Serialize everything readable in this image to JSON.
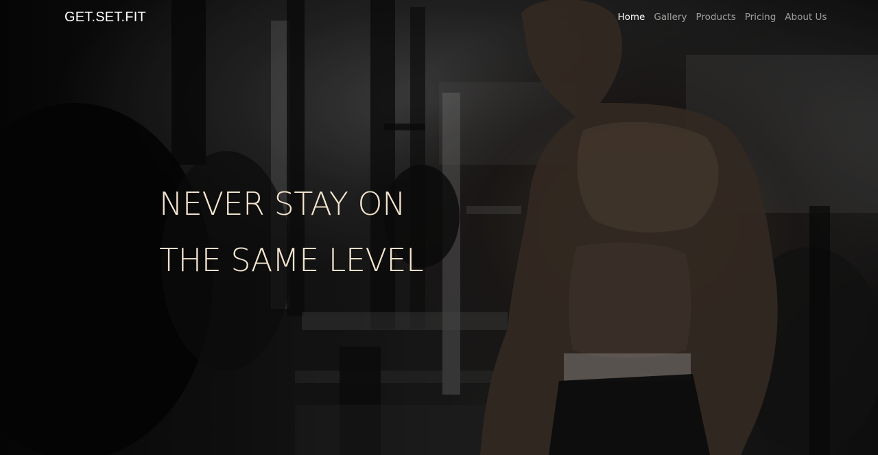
{
  "brand": {
    "name": "GET.SET.FIT"
  },
  "nav": {
    "items": [
      {
        "label": "Home",
        "active": true
      },
      {
        "label": "Gallery",
        "active": false
      },
      {
        "label": "Products",
        "active": false
      },
      {
        "label": "Pricing",
        "active": false
      },
      {
        "label": "About Us",
        "active": false
      }
    ]
  },
  "hero": {
    "headline_line1": "NEVER STAY ON",
    "headline_line2": "THE SAME LEVEL",
    "background_image": "gym-athlete-photo"
  },
  "colors": {
    "headline": "#f5e6cf",
    "nav_active": "#ffffff",
    "nav_inactive": "#9a9a9a",
    "brand": "#ffffff"
  }
}
